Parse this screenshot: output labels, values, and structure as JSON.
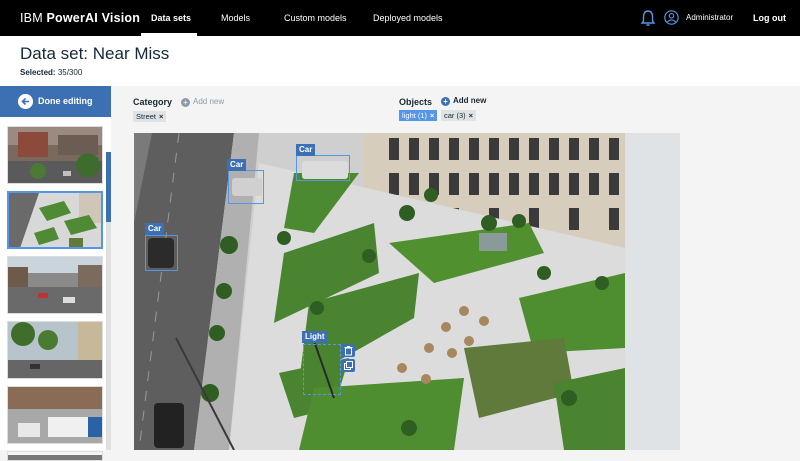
{
  "app": {
    "brand_prefix": "IBM",
    "brand_name": "PowerAI Vision"
  },
  "nav": {
    "items": [
      {
        "label": "Data sets",
        "active": true
      },
      {
        "label": "Models",
        "active": false
      },
      {
        "label": "Custom models",
        "active": false
      },
      {
        "label": "Deployed models",
        "active": false
      }
    ],
    "user": "Administrator",
    "logout": "Log out"
  },
  "page": {
    "title": "Data set: Near Miss",
    "selected_label": "Selected:",
    "selected_value": "35/300"
  },
  "sidebar": {
    "done_label": "Done editing",
    "thumbnail_count": 6,
    "selected_index": 1
  },
  "category": {
    "label": "Category",
    "add_label": "Add new",
    "tags": [
      {
        "label": "Street",
        "active": false
      }
    ]
  },
  "objects": {
    "label": "Objects",
    "add_label": "Add new",
    "tags": [
      {
        "label": "light (1)",
        "active": true
      },
      {
        "label": "car (3)",
        "active": false
      }
    ]
  },
  "annotations": [
    {
      "label": "Car"
    },
    {
      "label": "Car"
    },
    {
      "label": "Car"
    },
    {
      "label": "Light"
    }
  ],
  "colors": {
    "accent": "#3d70b2",
    "accent_light": "#5596e6",
    "topbar": "#000000"
  }
}
